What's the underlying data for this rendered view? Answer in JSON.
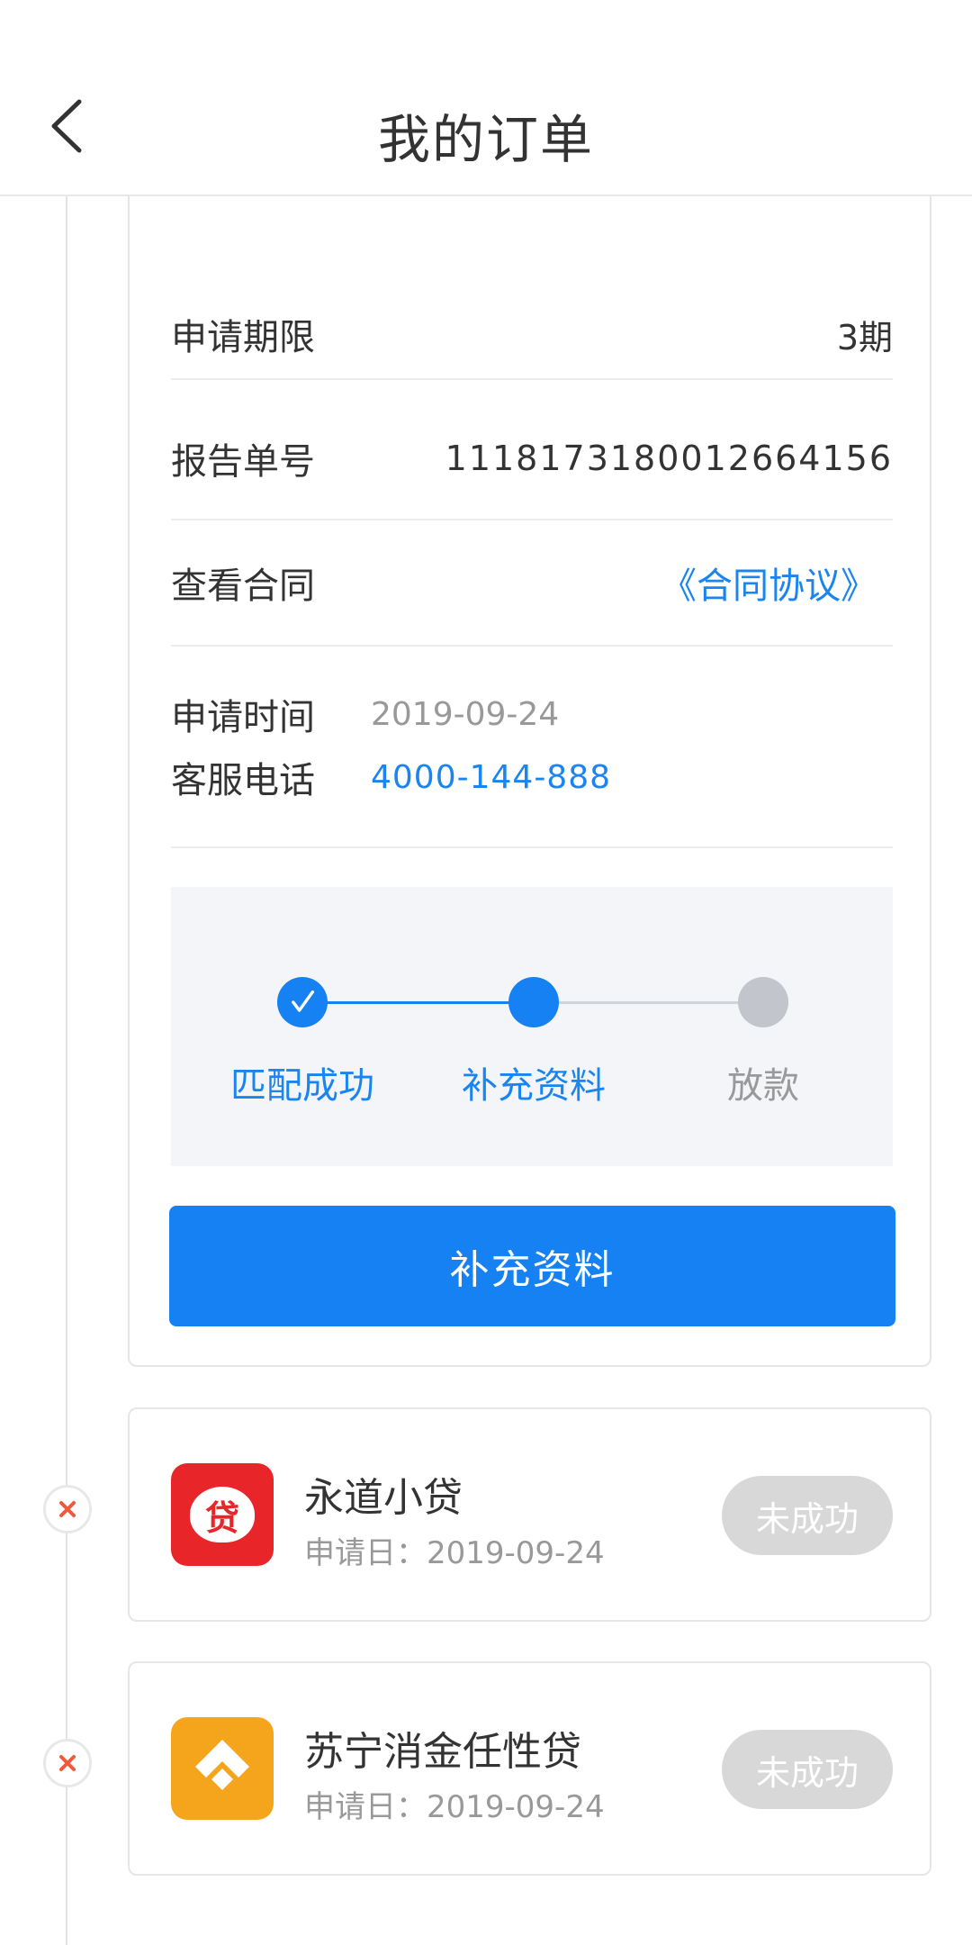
{
  "header": {
    "title": "我的订单"
  },
  "order": {
    "rows": [
      {
        "label": "申请期限",
        "value": "3期"
      },
      {
        "label": "报告单号",
        "value": "1118173180012664156"
      },
      {
        "label": "查看合同",
        "link": "《合同协议》"
      }
    ],
    "apply_time_label": "申请时间",
    "apply_time_value": "2019-09-24",
    "service_phone_label": "客服电话",
    "service_phone_value": "4000-144-888",
    "steps": [
      {
        "label": "匹配成功",
        "status": "done"
      },
      {
        "label": "补充资料",
        "status": "current"
      },
      {
        "label": "放款",
        "status": "pending"
      }
    ],
    "action_button": "补充资料"
  },
  "loans": [
    {
      "name": "永道小贷",
      "date": "申请日：2019-09-24",
      "status": "未成功",
      "logo_char": "贷",
      "logo_color": "#e8262a"
    },
    {
      "name": "苏宁消金任性贷",
      "date": "申请日：2019-09-24",
      "status": "未成功",
      "logo_color": "#f5a51c"
    }
  ],
  "colors": {
    "accent": "#1581f2",
    "link": "#1a85f0",
    "pending": "#c2c5cc",
    "fail": "#f05a3a"
  }
}
